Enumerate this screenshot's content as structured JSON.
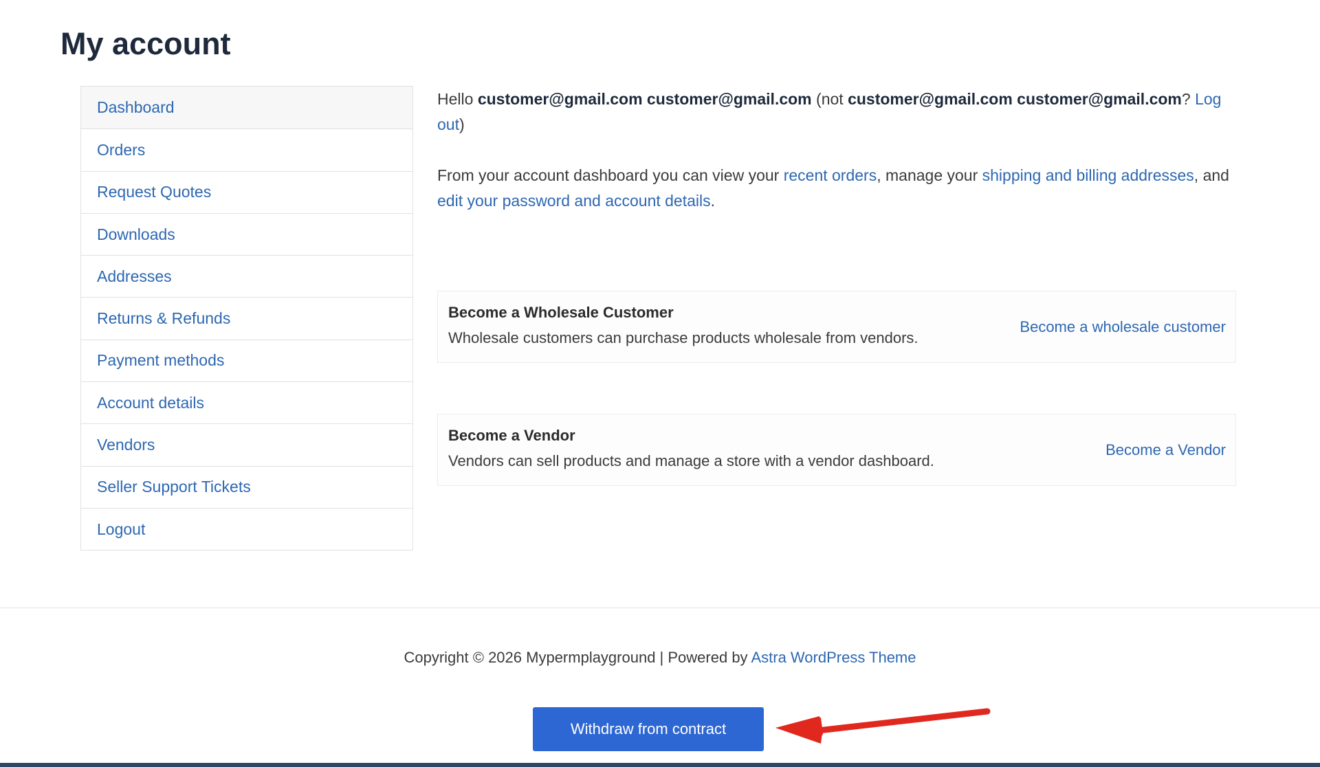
{
  "page": {
    "title": "My account"
  },
  "nav": {
    "items": [
      {
        "label": "Dashboard"
      },
      {
        "label": "Orders"
      },
      {
        "label": "Request Quotes"
      },
      {
        "label": "Downloads"
      },
      {
        "label": "Addresses"
      },
      {
        "label": "Returns & Refunds"
      },
      {
        "label": "Payment methods"
      },
      {
        "label": "Account details"
      },
      {
        "label": "Vendors"
      },
      {
        "label": "Seller Support Tickets"
      },
      {
        "label": "Logout"
      }
    ]
  },
  "greeting": {
    "hello": "Hello ",
    "user_name": "customer@gmail.com customer@gmail.com",
    "not_prefix": " (not ",
    "not_user": "customer@gmail.com customer@gmail.com",
    "question": "? ",
    "logout_link": "Log out",
    "close": ")"
  },
  "dashboard_intro": {
    "text1": "From your account dashboard you can view your ",
    "link_orders": "recent orders",
    "text2": ", manage your ",
    "link_addresses": "shipping and billing addresses",
    "text3": ", and ",
    "link_account": "edit your password and account details",
    "text4": "."
  },
  "cards": {
    "wholesale": {
      "title": "Become a Wholesale Customer",
      "description": "Wholesale customers can purchase products wholesale from vendors.",
      "link": "Become a wholesale customer"
    },
    "vendor": {
      "title": "Become a Vendor",
      "description": "Vendors can sell products and manage a store with a vendor dashboard.",
      "link": "Become a Vendor"
    }
  },
  "footer": {
    "copyright": "Copyright © 2026 Mypermplayground | Powered by ",
    "theme_link": "Astra WordPress Theme"
  },
  "withdraw_button": {
    "label": "Withdraw from contract"
  },
  "colors": {
    "link": "#2d67b2",
    "button": "#2d67d4",
    "annotation_arrow": "#e0281f",
    "bottom_bar": "#2d4663"
  },
  "icons": {
    "annotation": "red-arrow-icon"
  }
}
